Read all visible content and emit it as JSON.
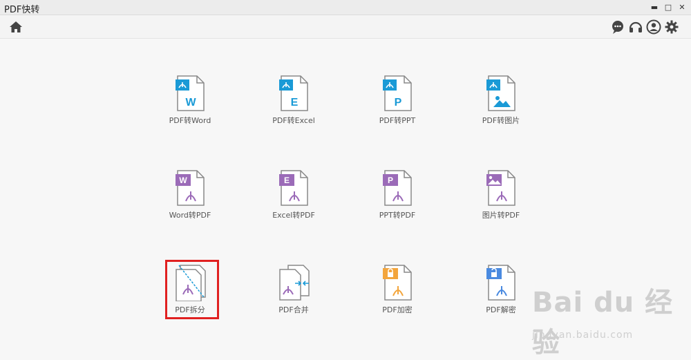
{
  "window": {
    "title": "PDF快转",
    "controls": {
      "minimize": "▬",
      "maximize": "□",
      "close": "✕"
    }
  },
  "toolbar": {
    "left_icon": "home-icon",
    "right_icons": [
      "chat-icon",
      "headset-icon",
      "user-icon",
      "gear-icon"
    ]
  },
  "colors": {
    "pdf_blue": "#1a9ad6",
    "pdf_purple": "#9b6bb8",
    "lock_orange": "#f3a53c",
    "lock_blue": "#4a8ae0",
    "highlight_red": "#e02020"
  },
  "tools": [
    {
      "label": "PDF转Word",
      "letter": "W"
    },
    {
      "label": "PDF转Excel",
      "letter": "E"
    },
    {
      "label": "PDF转PPT",
      "letter": "P"
    },
    {
      "label": "PDF转图片"
    },
    {
      "label": "Word转PDF",
      "letter": "W"
    },
    {
      "label": "Excel转PDF",
      "letter": "E"
    },
    {
      "label": "PPT转PDF",
      "letter": "P"
    },
    {
      "label": "图片转PDF"
    },
    {
      "label": "PDF拆分"
    },
    {
      "label": "PDF合并"
    },
    {
      "label": "PDF加密"
    },
    {
      "label": "PDF解密"
    }
  ],
  "watermark": {
    "main": "Bai du 经验",
    "sub": "jingyan.baidu.com"
  }
}
